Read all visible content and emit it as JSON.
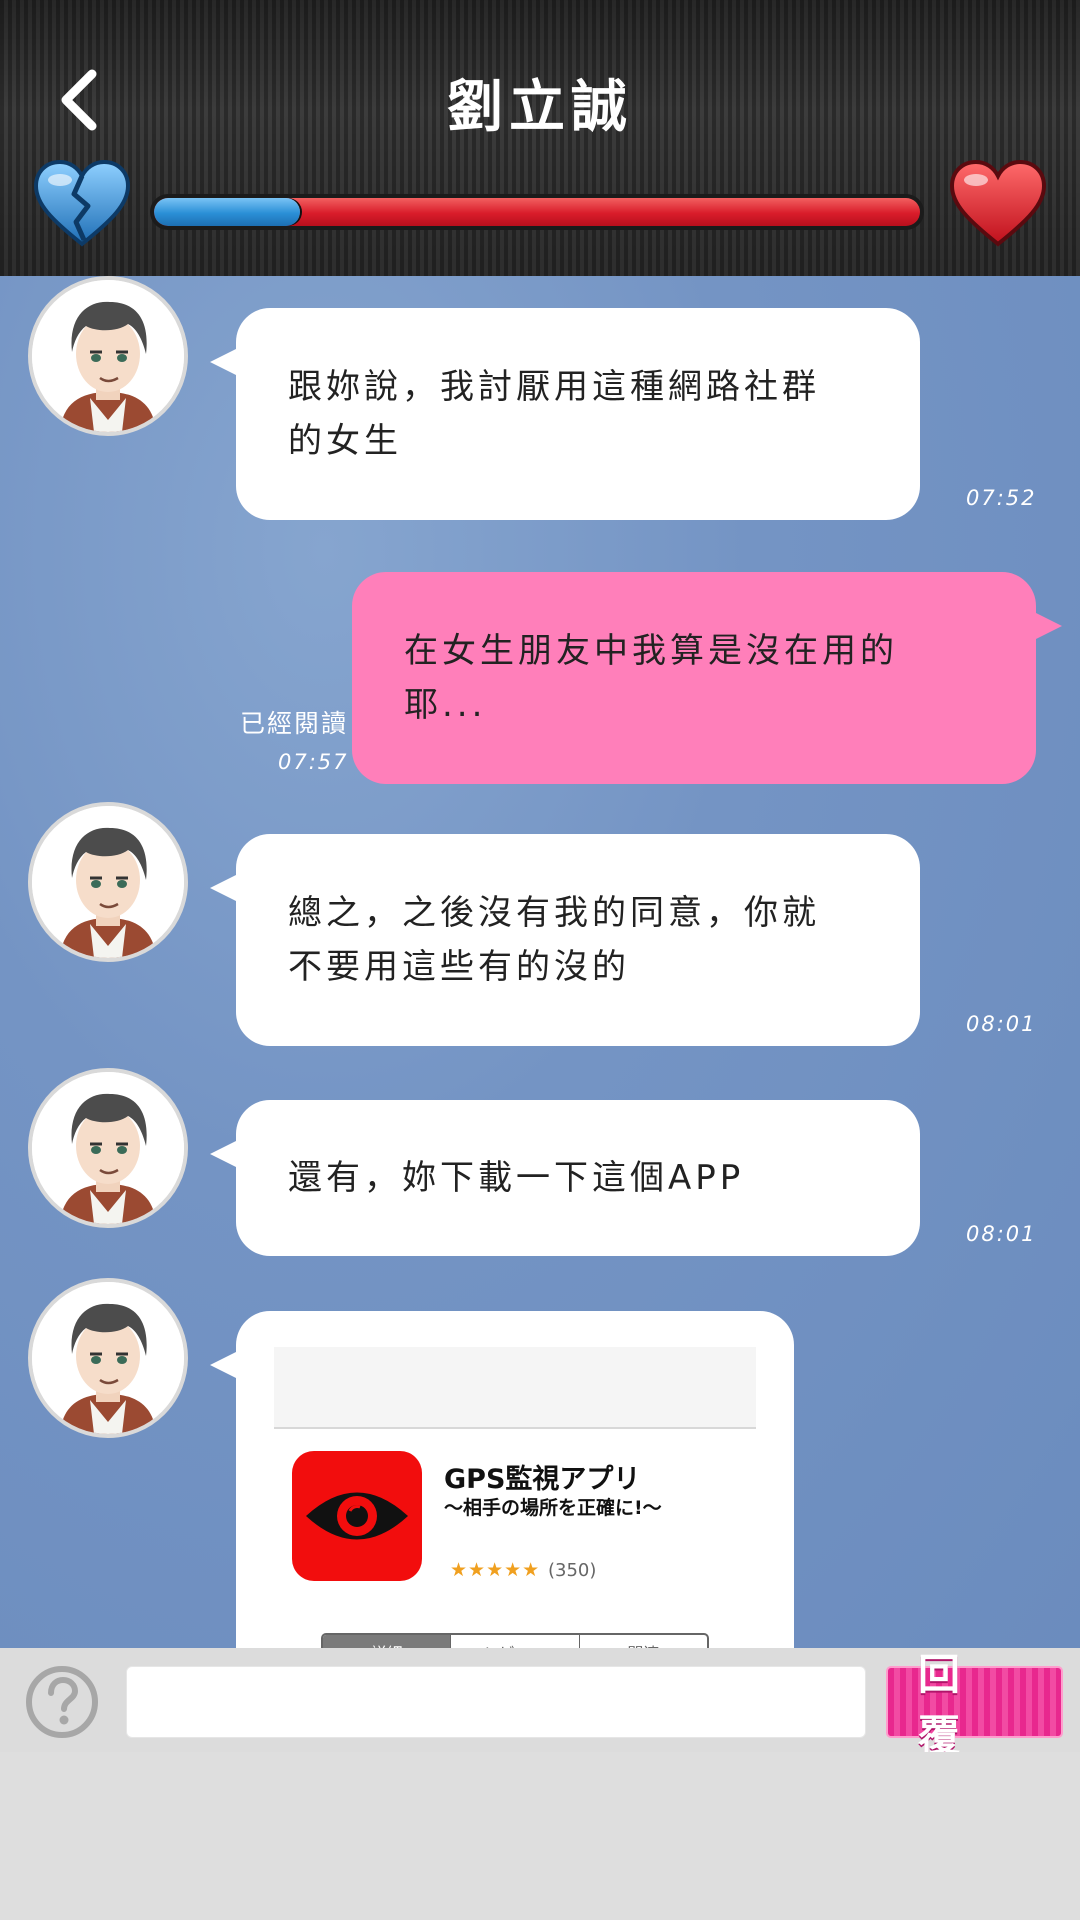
{
  "header": {
    "title": "劉立誠",
    "back_icon": "chevron-left-icon",
    "left_meter_icon": "broken-heart-icon",
    "right_meter_icon": "heart-icon",
    "affection_meter": {
      "value": 0.19,
      "fill_color": "#2a8fd6",
      "track_color": "#d91c2a"
    }
  },
  "messages": [
    {
      "sender": "contact",
      "text_line1": "跟妳說，我討厭用這種網路社群",
      "text_line2": "的女生",
      "time": "07:52"
    },
    {
      "sender": "me",
      "text_line1": "在女生朋友中我算是沒在用的",
      "text_line2": "耶...",
      "read_status": "已經閱讀",
      "time": "07:57"
    },
    {
      "sender": "contact",
      "text_line1": "總之，之後沒有我的同意，你就",
      "text_line2": "不要用這些有的沒的",
      "time": "08:01"
    },
    {
      "sender": "contact",
      "text_line1": "還有，妳下載一下這個APP",
      "time": "08:01"
    }
  ],
  "app_card": {
    "app_name": "GPS監視アプリ",
    "app_subtitle": "〜相手の場所を正確に!〜",
    "stars": "★★★★★",
    "rating_count": "(350)",
    "tabs": [
      "詳細",
      "レビュー",
      "関連"
    ],
    "active_tab": "詳細",
    "icon": "eye-icon",
    "icon_bg": "#f20d0d"
  },
  "bottom_bar": {
    "help_icon": "question-icon",
    "input_value": "",
    "input_placeholder": "",
    "reply_label": "回覆",
    "reply_color": "#e8288e"
  },
  "colors": {
    "chat_background": "#7494c4",
    "my_bubble": "#ff7fba",
    "contact_bubble": "#ffffff"
  }
}
